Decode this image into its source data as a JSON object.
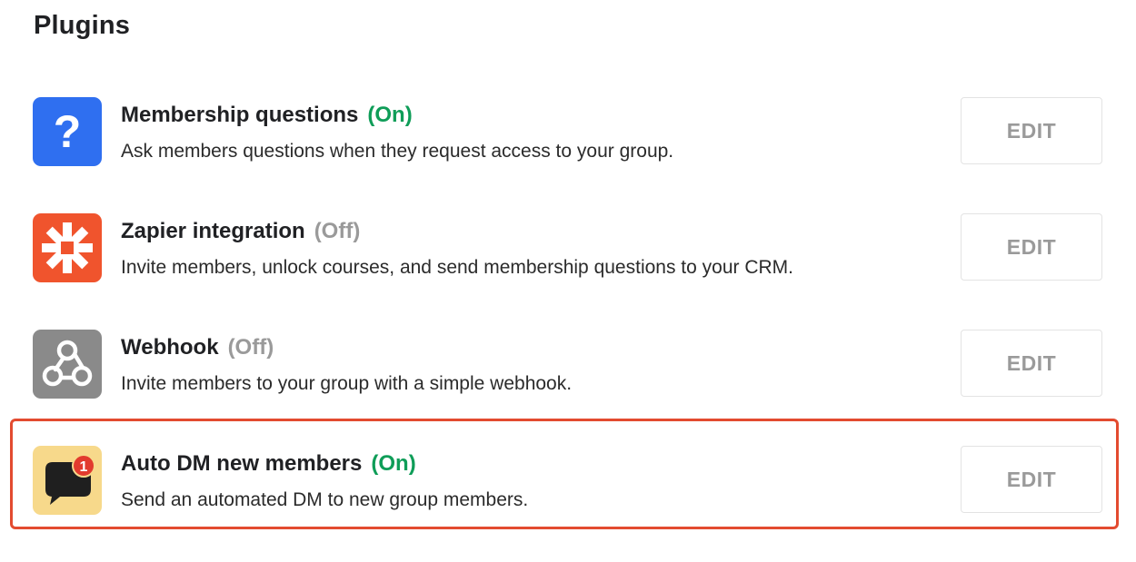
{
  "page": {
    "title": "Plugins"
  },
  "plugins": [
    {
      "name": "Membership questions",
      "status": "(On)",
      "description": "Ask members questions when they request access to your group.",
      "icon": "question-mark-icon",
      "icon_color": "#2f6ff0",
      "edit_label": "EDIT"
    },
    {
      "name": "Zapier integration",
      "status": "(Off)",
      "description": "Invite members, unlock courses, and send membership questions to your CRM.",
      "icon": "zapier-asterisk-icon",
      "icon_color": "#f0542d",
      "edit_label": "EDIT"
    },
    {
      "name": "Webhook",
      "status": "(Off)",
      "description": "Invite members to your group with a simple webhook.",
      "icon": "webhook-icon",
      "icon_color": "#8a8a8a",
      "edit_label": "EDIT"
    },
    {
      "name": "Auto DM new members",
      "status": "(On)",
      "description": "Send an automated DM to new group members.",
      "icon": "chat-bubble-badge-icon",
      "icon_color": "#f7d98b",
      "badge_count": "1",
      "edit_label": "EDIT"
    }
  ],
  "colors": {
    "status_on": "#0f9d58",
    "status_off": "#9a9a9a",
    "highlight_border": "#e34b30"
  }
}
